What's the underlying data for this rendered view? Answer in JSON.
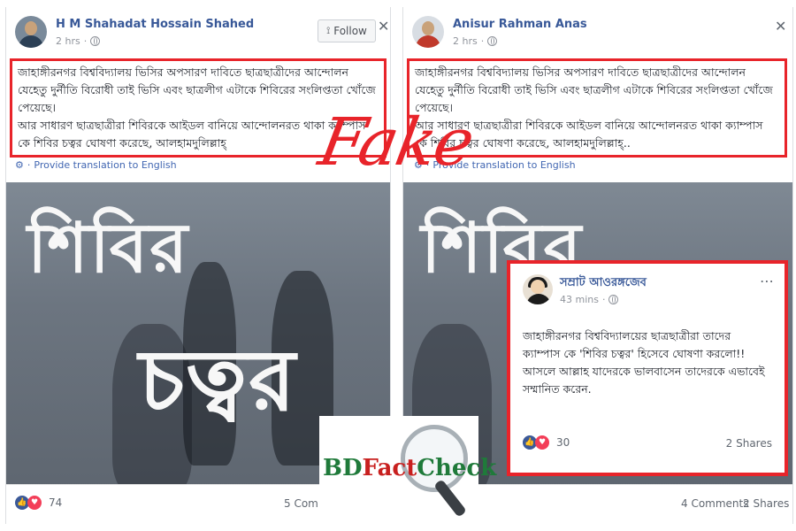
{
  "left_post": {
    "author": "H M Shahadat Hossain Shahed",
    "time": "2 hrs",
    "follow_label": "Follow",
    "text_lines": [
      "জাহাঙ্গীরনগর বিশ্ববিদ্যালয় ভিসির অপসারণ দাবিতে ছাত্রছাত্রীদের আন্দোলন",
      "যেহেতু দুর্নীতি বিরোধী তাই ভিসি এবং ছাত্রলীগ এটাকে শিবিরের সংলিপ্ততা খোঁজে",
      "পেয়েছে।",
      "আর সাধারণ ছাত্রছাত্রীরা শিবিরকে আইডল বানিয়ে আন্দোলনরত থাকা ক্যাম্পাস",
      "কে শিবির চত্বর ঘোষণা করেছে, আলহামদুলিল্লাহ্"
    ],
    "translate": "Provide translation to English",
    "photo_text_top": "শিবির",
    "photo_text_bottom": "চত্বর",
    "reactions": "74",
    "comments": "5 Com"
  },
  "right_post": {
    "author": "Anisur Rahman Anas",
    "time": "2 hrs",
    "text_lines": [
      "জাহাঙ্গীরনগর বিশ্ববিদ্যালয় ভিসির অপসারণ দাবিতে ছাত্রছাত্রীদের আন্দোলন",
      "যেহেতু দুর্নীতি বিরোধী তাই ভিসি এবং ছাত্রলীগ এটাকে শিবিরের সংলিপ্ততা খোঁজে",
      "পেয়েছে।",
      "আর সাধারণ ছাত্রছাত্রীরা শিবিরকে আইডল বানিয়ে আন্দোলনরত থাকা ক্যাম্পাস",
      "কে শিবির চত্বর ঘোষণা করেছে, আলহামদুলিল্লাহ্.."
    ],
    "translate": "Provide translation to English",
    "photo_text_top": "শিবির",
    "comments": "4 Comments",
    "shares": "2 Shares"
  },
  "inner_post": {
    "author": "সম্রাট আওরঙ্গজেব",
    "time": "43 mins",
    "text_lines": [
      "জাহাঙ্গীরনগর বিশ্ববিদ্যালয়ের ছাত্রছাত্রীরা তাদের",
      "ক্যাম্পাস কে 'শিবির চত্বর' হিসেবে ঘোষণা করলো!!",
      "আসলে আল্লাহ যাদেরকে ভালবাসেন তাদেরকে এভাবেই",
      "সম্মানিত করেন."
    ],
    "reactions": "30",
    "shares": "2 Shares"
  },
  "overlay": {
    "fake_label": "Fake",
    "logo_bd": "BD",
    "logo_fact": "Fact",
    "logo_check": "Check"
  },
  "colors": {
    "highlight_red": "#e8242a",
    "link_blue": "#385898",
    "logo_green": "#1f7a3a"
  }
}
